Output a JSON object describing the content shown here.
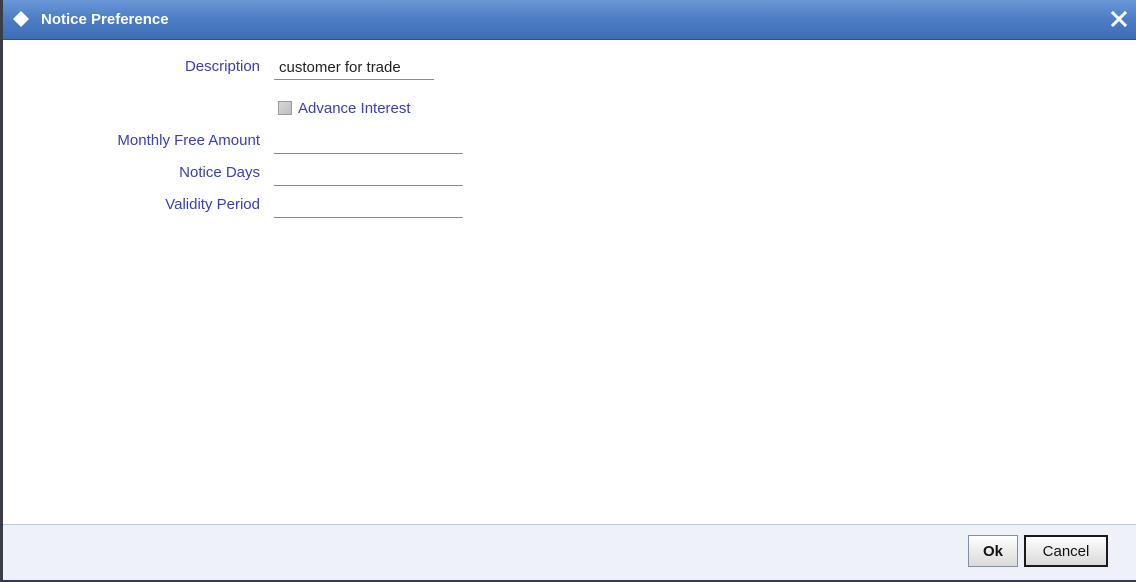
{
  "window": {
    "title": "Notice Preference",
    "title_icon": "diamond-icon",
    "close_icon": "close-icon",
    "colors": {
      "titlebar": "#4e7fc6",
      "label": "#3b3fb0",
      "footer": "#eef2f8"
    }
  },
  "form": {
    "description": {
      "label": "Description",
      "value": "customer for trade"
    },
    "advance_interest": {
      "label": "Advance Interest",
      "checked": false,
      "disabled": true
    },
    "monthly_free_amount": {
      "label": "Monthly Free Amount",
      "value": ""
    },
    "notice_days": {
      "label": "Notice Days",
      "value": ""
    },
    "validity_period": {
      "label": "Validity Period",
      "value": ""
    }
  },
  "footer": {
    "ok_label": "Ok",
    "cancel_label": "Cancel"
  }
}
